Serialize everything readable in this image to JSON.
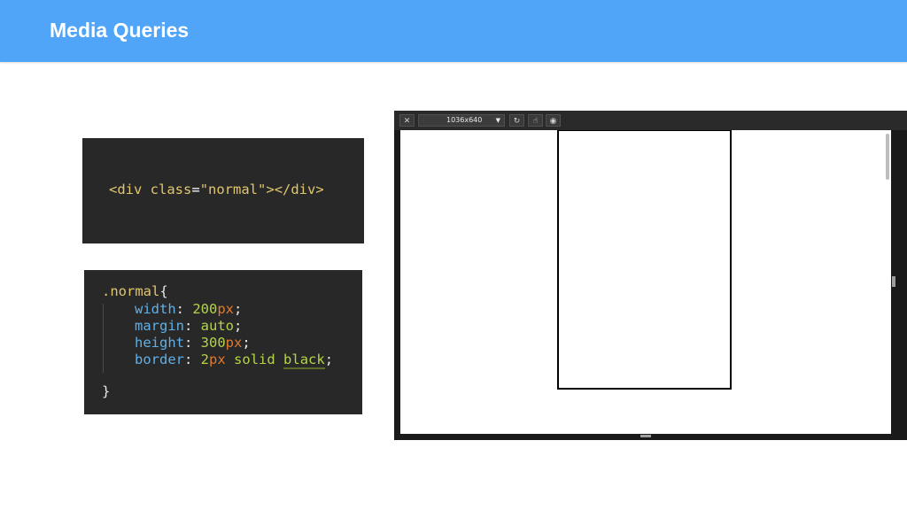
{
  "header": {
    "title": "Media Queries"
  },
  "code_html": {
    "open_tag": "<div",
    "attr": "class",
    "eq": "=",
    "value": "\"normal\"",
    "close_open": ">",
    "close_tag": "</div>"
  },
  "code_css": {
    "selector": ".normal",
    "open_brace": "{",
    "close_brace": "}",
    "rules": [
      {
        "prop": "width",
        "num": "200",
        "unit": "px"
      },
      {
        "prop": "margin",
        "val": "auto"
      },
      {
        "prop": "height",
        "num": "300",
        "unit": "px"
      },
      {
        "prop": "border",
        "num": "2",
        "unit": "px",
        "rest": "solid",
        "color": "black"
      }
    ]
  },
  "browser": {
    "close_icon": "✕",
    "size_value": "1036x640",
    "size_arrow": "▼",
    "rotate_icon": "↻",
    "touch_icon": "☝",
    "screenshot_icon": "◉"
  }
}
